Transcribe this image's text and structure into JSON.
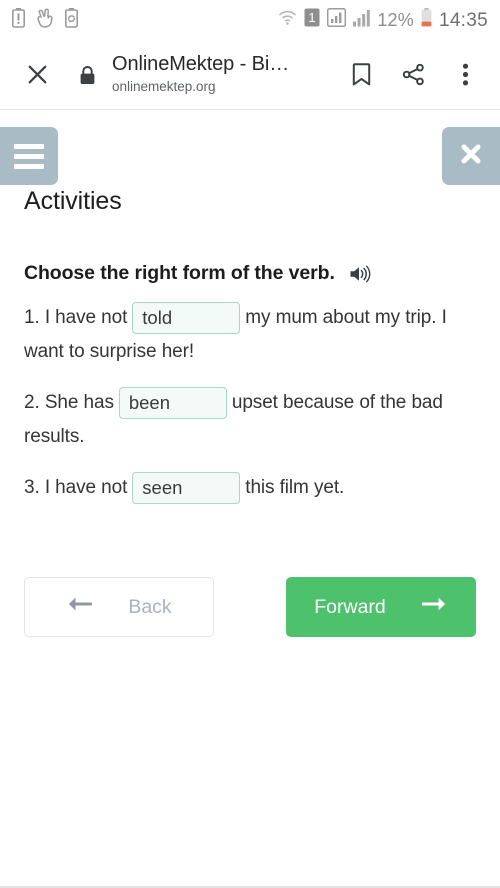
{
  "status_bar": {
    "left_icons": [
      "battery-alert-icon",
      "hand-peace-icon",
      "battery-sync-icon"
    ],
    "wifi_icon": "wifi-icon",
    "sim_label": "1",
    "signal_icons": [
      "signal-bars-boxed-icon",
      "signal-bars-icon"
    ],
    "battery_percent": "12%",
    "battery_icon": "battery-low-icon",
    "clock": "14:35"
  },
  "toolbar": {
    "close_label": "close-icon",
    "lock_label": "lock-icon",
    "title": "OnlineMektep - Bi…",
    "url": "onlinemektep.org",
    "bookmark_label": "bookmark-icon",
    "share_label": "share-icon",
    "menu_label": "overflow-menu-icon"
  },
  "page_header": {
    "menu_button_label": "menu-icon",
    "close_button_label": "close-icon",
    "title": "Activities",
    "button_color": "#a9bcc6"
  },
  "exercise": {
    "prompt": "Choose the right form of the verb.",
    "audio_icon": "speaker-icon",
    "questions": [
      {
        "before": "1. I have not",
        "answer": "told",
        "after": "my mum about my trip. I want to surprise her!"
      },
      {
        "before": "2. She has",
        "answer": "been",
        "after": "upset because of the bad results."
      },
      {
        "before": "3. I have not",
        "answer": "seen",
        "after": "this film yet."
      }
    ],
    "input_border_color": "#a8d7c5",
    "input_background_color": "#f4faf7"
  },
  "navigation": {
    "back_label": "Back",
    "back_icon": "arrow-left-icon",
    "forward_label": "Forward",
    "forward_icon": "arrow-right-icon",
    "forward_color": "#4ec16d",
    "back_text_color": "#aab2ba"
  }
}
